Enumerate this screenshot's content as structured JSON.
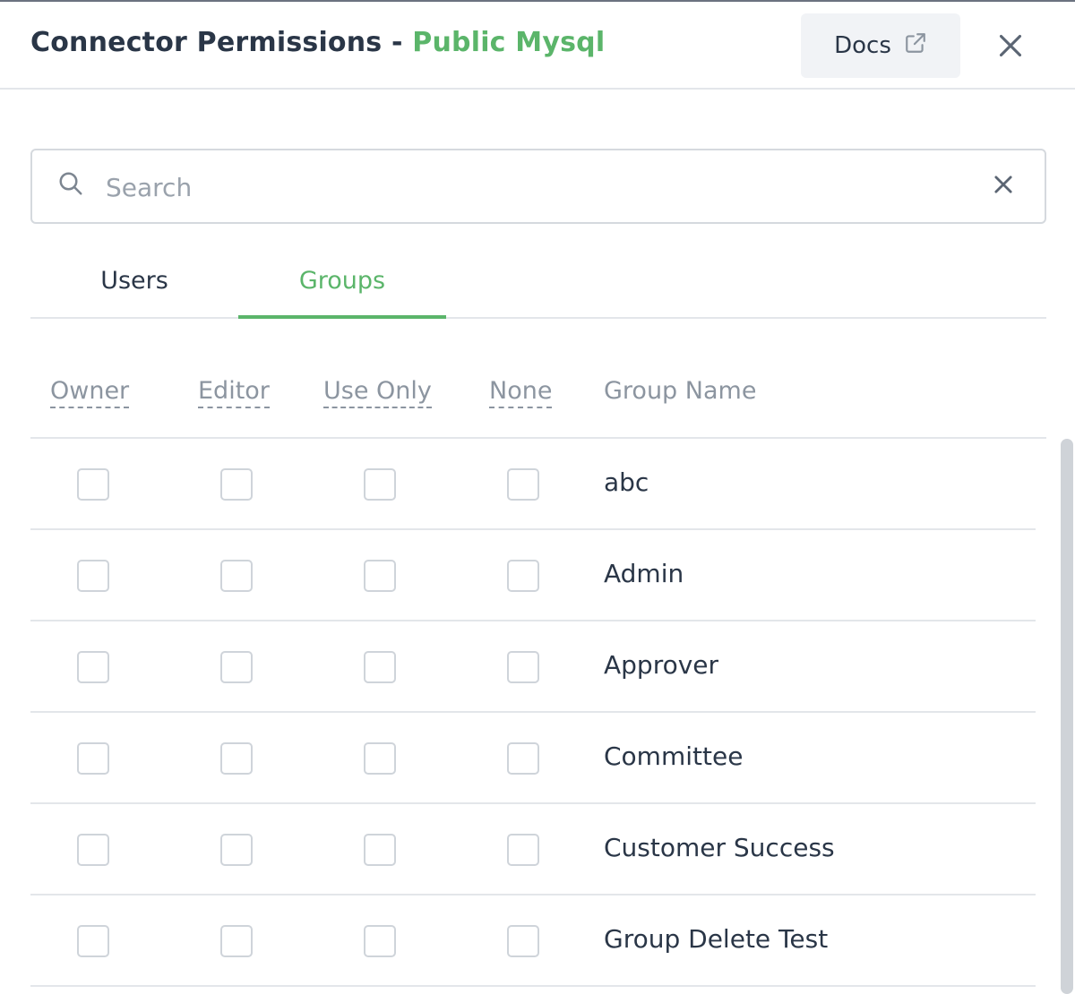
{
  "header": {
    "title_prefix": "Connector Permissions - ",
    "title_accent": "Public Mysql",
    "docs_label": "Docs",
    "docs_icon": "external-link-icon",
    "close_icon": "close-icon"
  },
  "search": {
    "placeholder": "Search",
    "value": "",
    "icon": "search-icon",
    "clear_icon": "close-icon"
  },
  "tabs": [
    {
      "label": "Users",
      "active": false
    },
    {
      "label": "Groups",
      "active": true
    }
  ],
  "columns": {
    "owner": "Owner",
    "editor": "Editor",
    "use_only": "Use Only",
    "none": "None",
    "group_name": "Group Name"
  },
  "rows": [
    {
      "name": "abc",
      "owner": false,
      "editor": false,
      "use_only": false,
      "none": false
    },
    {
      "name": "Admin",
      "owner": false,
      "editor": false,
      "use_only": false,
      "none": false
    },
    {
      "name": "Approver",
      "owner": false,
      "editor": false,
      "use_only": false,
      "none": false
    },
    {
      "name": "Committee",
      "owner": false,
      "editor": false,
      "use_only": false,
      "none": false
    },
    {
      "name": "Customer Success",
      "owner": false,
      "editor": false,
      "use_only": false,
      "none": false
    },
    {
      "name": "Group Delete Test",
      "owner": false,
      "editor": false,
      "use_only": false,
      "none": false
    }
  ],
  "colors": {
    "accent": "#5bb56a",
    "text": "#2a3647",
    "muted": "#8c95a0",
    "border": "#e3e6ea"
  }
}
